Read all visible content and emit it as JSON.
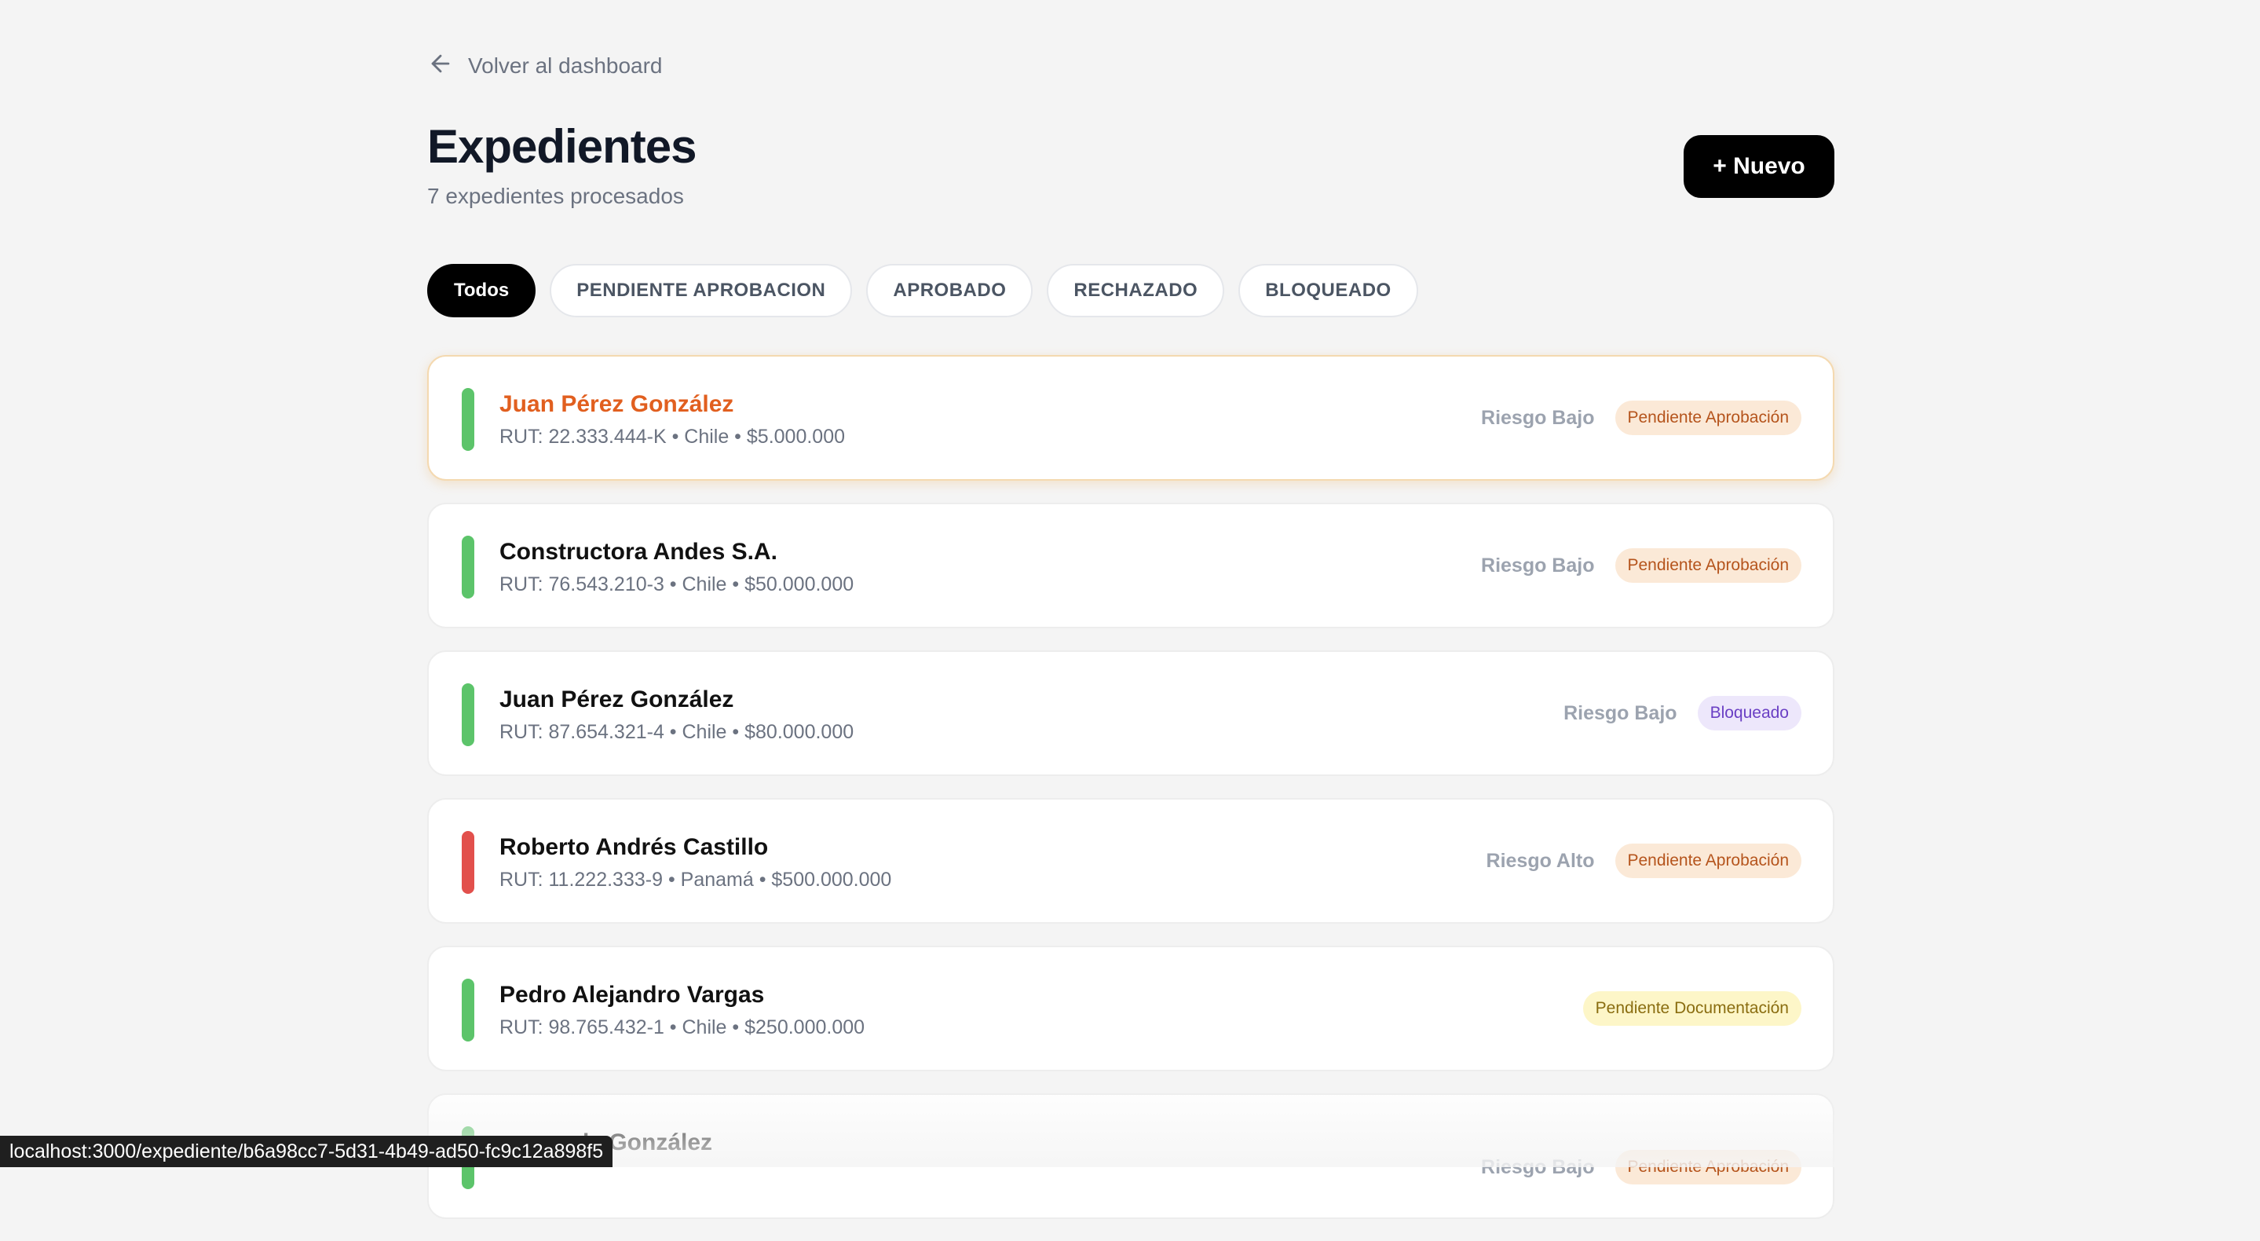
{
  "nav": {
    "back_label": "Volver al dashboard"
  },
  "header": {
    "title": "Expedientes",
    "subtitle": "7 expedientes procesados",
    "new_button": "+ Nuevo"
  },
  "filters": [
    "Todos",
    "PENDIENTE APROBACION",
    "APROBADO",
    "RECHAZADO",
    "BLOQUEADO"
  ],
  "active_filter": "Todos",
  "expedientes": [
    {
      "name": "Juan Pérez González",
      "meta": "RUT: 22.333.444-K • Chile • $5.000.000",
      "risk": "Riesgo Bajo",
      "status": "Pendiente Aprobación",
      "indicator": "green",
      "selected": true
    },
    {
      "name": "Constructora Andes S.A.",
      "meta": "RUT: 76.543.210-3 • Chile • $50.000.000",
      "risk": "Riesgo Bajo",
      "status": "Pendiente Aprobación",
      "indicator": "green"
    },
    {
      "name": "Juan Pérez González",
      "meta": "RUT: 87.654.321-4 • Chile • $80.000.000",
      "risk": "Riesgo Bajo",
      "status": "Bloqueado",
      "indicator": "green"
    },
    {
      "name": "Roberto Andrés Castillo",
      "meta": "RUT: 11.222.333-9 • Panamá • $500.000.000",
      "risk": "Riesgo Alto",
      "status": "Pendiente Aprobación",
      "indicator": "red"
    },
    {
      "name": "Pedro Alejandro Vargas",
      "meta": "RUT: 98.765.432-1 • Chile • $250.000.000",
      "risk": "",
      "status": "Pendiente Documentación",
      "indicator": "green"
    },
    {
      "name": "da González",
      "meta": "",
      "risk": "Riesgo Bajo",
      "status": "Pendiente Aprobación",
      "indicator": "green"
    }
  ],
  "colors": {
    "indicator_green": "#5cc46a",
    "indicator_red": "#e2504c",
    "badge_pending_bg": "#fbe9d7",
    "badge_pending_fg": "#b5541c",
    "badge_blocked_bg": "#ede7fb",
    "badge_blocked_fg": "#6a3fc4",
    "badge_doc_bg": "#fdf6c8",
    "badge_doc_fg": "#8a6d10"
  },
  "status_bar": {
    "url": "localhost:3000/expediente/b6a98cc7-5d31-4b49-ad50-fc9c12a898f5"
  },
  "icons": {
    "back": "arrow-left-icon"
  }
}
